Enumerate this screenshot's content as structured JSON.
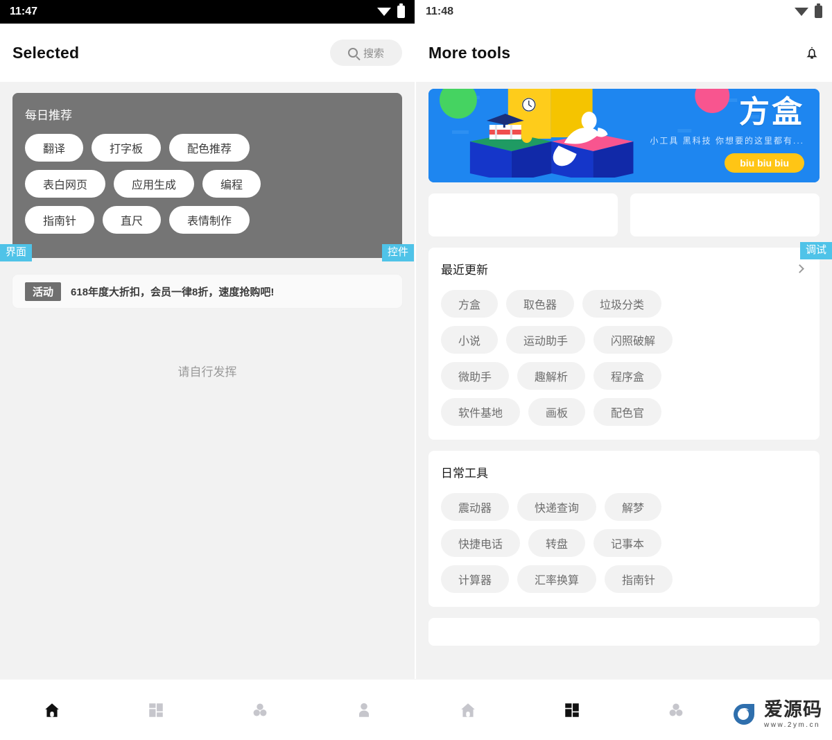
{
  "left": {
    "status": {
      "time": "11:47",
      "wifi_icon": "wifi-icon",
      "battery_icon": "battery-icon"
    },
    "appbar": {
      "title": "Selected",
      "search": {
        "icon": "search-icon",
        "label": "搜索"
      }
    },
    "daily_card": {
      "title": "每日推荐",
      "chip_rows": [
        [
          "翻译",
          "打字板",
          "配色推荐"
        ],
        [
          "表白网页",
          "应用生成",
          "编程"
        ],
        [
          "指南针",
          "直尺",
          "表情制作"
        ]
      ]
    },
    "badges": {
      "interface": "界面",
      "widget": "控件"
    },
    "notice": {
      "tag": "活动",
      "text": "618年度大折扣，会员一律8折，速度抢购吧!"
    },
    "placeholder": "请自行发挥"
  },
  "right": {
    "status": {
      "time": "11:48",
      "wifi_icon": "wifi-icon",
      "battery_icon": "battery-icon"
    },
    "appbar": {
      "title": "More tools",
      "bell_icon": "bell-icon"
    },
    "badges": {
      "debug": "调试"
    },
    "banner": {
      "title": "方盒",
      "subtitle": "小工具 黑科技 你想要的这里都有...",
      "button": "biu biu biu",
      "bg_color": "#1e86f0",
      "button_color": "#ffc515"
    },
    "sections": [
      {
        "title": "最近更新",
        "chevron_icon": "chevron-right-icon",
        "chip_rows": [
          [
            "方盒",
            "取色器",
            "垃圾分类"
          ],
          [
            "小说",
            "运动助手",
            "闪照破解"
          ],
          [
            "微助手",
            "趣解析",
            "程序盒"
          ],
          [
            "软件基地",
            "画板",
            "配色官"
          ]
        ]
      },
      {
        "title": "日常工具",
        "chip_rows": [
          [
            "震动器",
            "快递查询",
            "解梦"
          ],
          [
            "快捷电话",
            "转盘",
            "记事本"
          ],
          [
            "计算器",
            "汇率换算",
            "指南针"
          ]
        ]
      }
    ]
  },
  "bottom_nav": {
    "left_items": [
      {
        "icon": "home-icon",
        "active": true
      },
      {
        "icon": "dashboard-icon",
        "active": false
      },
      {
        "icon": "group-icon",
        "active": false
      },
      {
        "icon": "person-icon",
        "active": false
      }
    ],
    "right_items": [
      {
        "icon": "home-icon",
        "active": false
      },
      {
        "icon": "dashboard-icon",
        "active": true
      },
      {
        "icon": "group-icon",
        "active": false
      }
    ],
    "active_color": "#111111",
    "inactive_color": "#c6c6cc"
  },
  "watermark": {
    "name": "爱源码",
    "url": "www.2ym.cn",
    "logo_color": "#2f6fad"
  }
}
